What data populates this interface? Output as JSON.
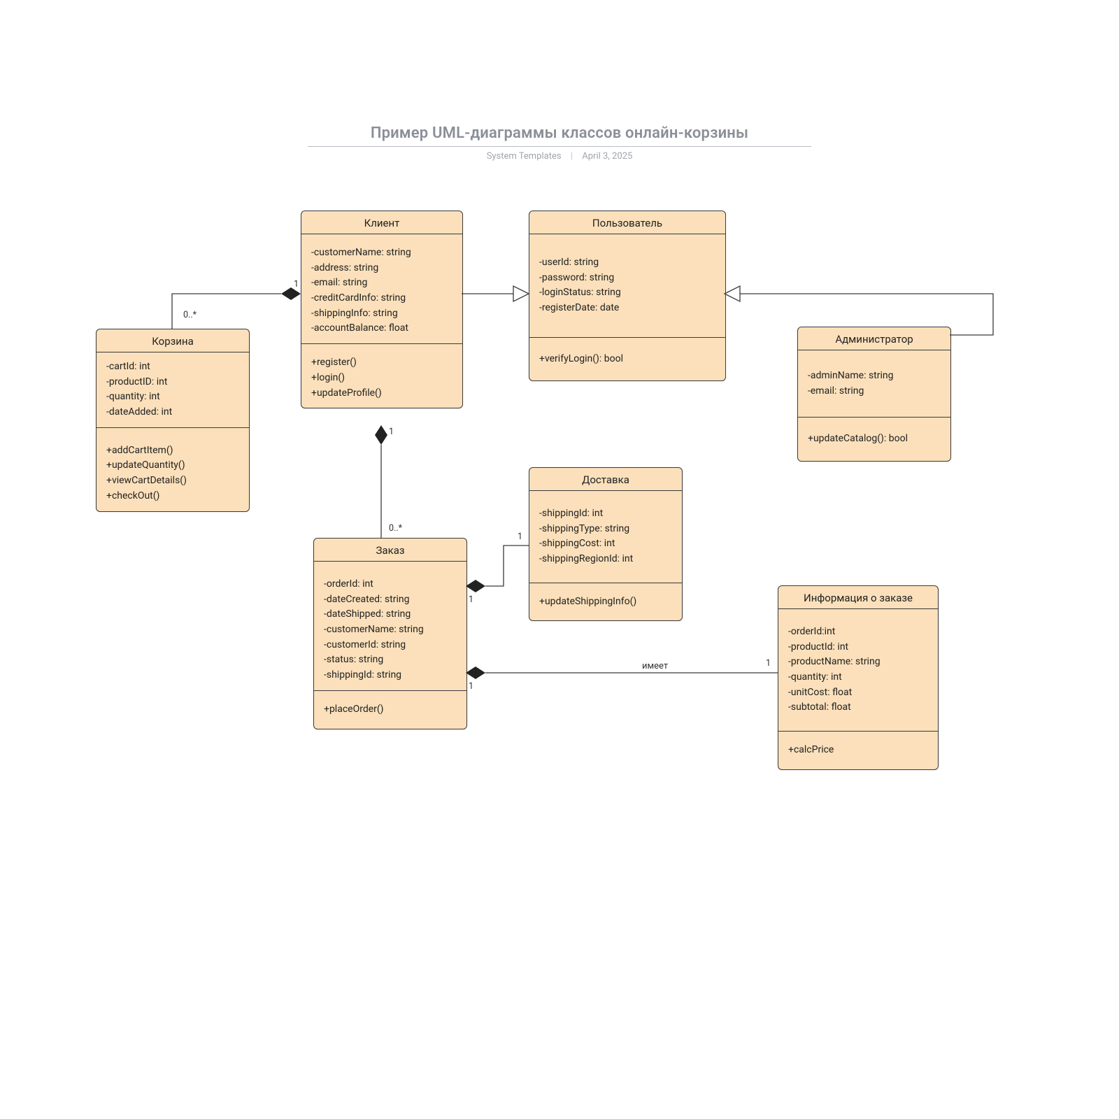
{
  "header": {
    "title": "Пример UML-диаграммы классов онлайн-корзины",
    "subtitle_left": "System Templates",
    "subtitle_right": "April 3, 2025"
  },
  "classes": {
    "cart": {
      "name": "Корзина",
      "attrs": [
        "-cartId: int",
        "-productID: int",
        "-quantity: int",
        "-dateAdded: int"
      ],
      "ops": [
        "+addCartItem()",
        "+updateQuantity()",
        "+viewCartDetails()",
        "+checkOut()"
      ]
    },
    "client": {
      "name": "Клиент",
      "attrs": [
        "-customerName: string",
        "-address: string",
        "-email: string",
        "-creditCardInfo: string",
        "-shippingInfo: string",
        "-accountBalance: float"
      ],
      "ops": [
        "+register()",
        "+login()",
        "+updateProfile()"
      ]
    },
    "user": {
      "name": "Пользователь",
      "attrs": [
        "-userId: string",
        "-password: string",
        "-loginStatus: string",
        "-registerDate: date"
      ],
      "ops": [
        "+verifyLogin(): bool"
      ]
    },
    "admin": {
      "name": "Администратор",
      "attrs": [
        "-adminName: string",
        "-email: string"
      ],
      "ops": [
        "+updateCatalog(): bool"
      ]
    },
    "order": {
      "name": "Заказ",
      "attrs": [
        "-orderId: int",
        "-dateCreated: string",
        "-dateShipped: string",
        "-customerName: string",
        "-customerId: string",
        "-status: string",
        "-shippingId: string"
      ],
      "ops": [
        "+placeOrder()"
      ]
    },
    "shipping": {
      "name": "Доставка",
      "attrs": [
        "-shippingId: int",
        "-shippingType: string",
        "-shippingCost: int",
        "-shippingRegionId: int"
      ],
      "ops": [
        "+updateShippingInfo()"
      ]
    },
    "orderinfo": {
      "name": "Информация о заказе",
      "attrs": [
        "-orderId:int",
        "-productId: int",
        "-productName: string",
        "-quantity: int",
        "-unitCost: float",
        "-subtotal: float"
      ],
      "ops": [
        "+calcPrice"
      ]
    }
  },
  "multiplicities": {
    "cart_side": "0..*",
    "client_side": "1",
    "client_bottom": "1",
    "order_top": "0..*",
    "order_right_upper": "1",
    "shipping_left": "1",
    "order_right_lower": "1",
    "orderinfo_left": "1"
  },
  "assoc_labels": {
    "order_orderinfo": "имеет"
  }
}
